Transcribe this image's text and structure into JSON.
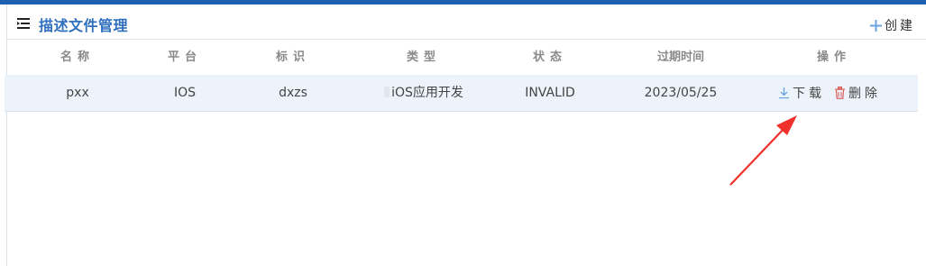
{
  "header": {
    "title": "描述文件管理",
    "create_label": "创建",
    "icons": {
      "menu": "list-menu-icon",
      "create": "plus-icon"
    }
  },
  "table": {
    "columns": [
      "名称",
      "平台",
      "标识",
      "类型",
      "状态",
      "过期时间",
      "操作"
    ],
    "rows": [
      {
        "name": "pxx",
        "platform": "IOS",
        "identifier": "dxzs",
        "type": "iOS应用开发",
        "status": "INVALID",
        "expire": "2023/05/25",
        "actions": {
          "download": "下载",
          "delete": "删除"
        }
      }
    ]
  },
  "colors": {
    "accent": "#2f6fbf",
    "top_bar": "#1d5fb0",
    "row_highlight": "#edf3fb",
    "download_icon": "#6aa4e0",
    "delete_icon": "#d9534f",
    "annotation_arrow": "#f0302a"
  }
}
